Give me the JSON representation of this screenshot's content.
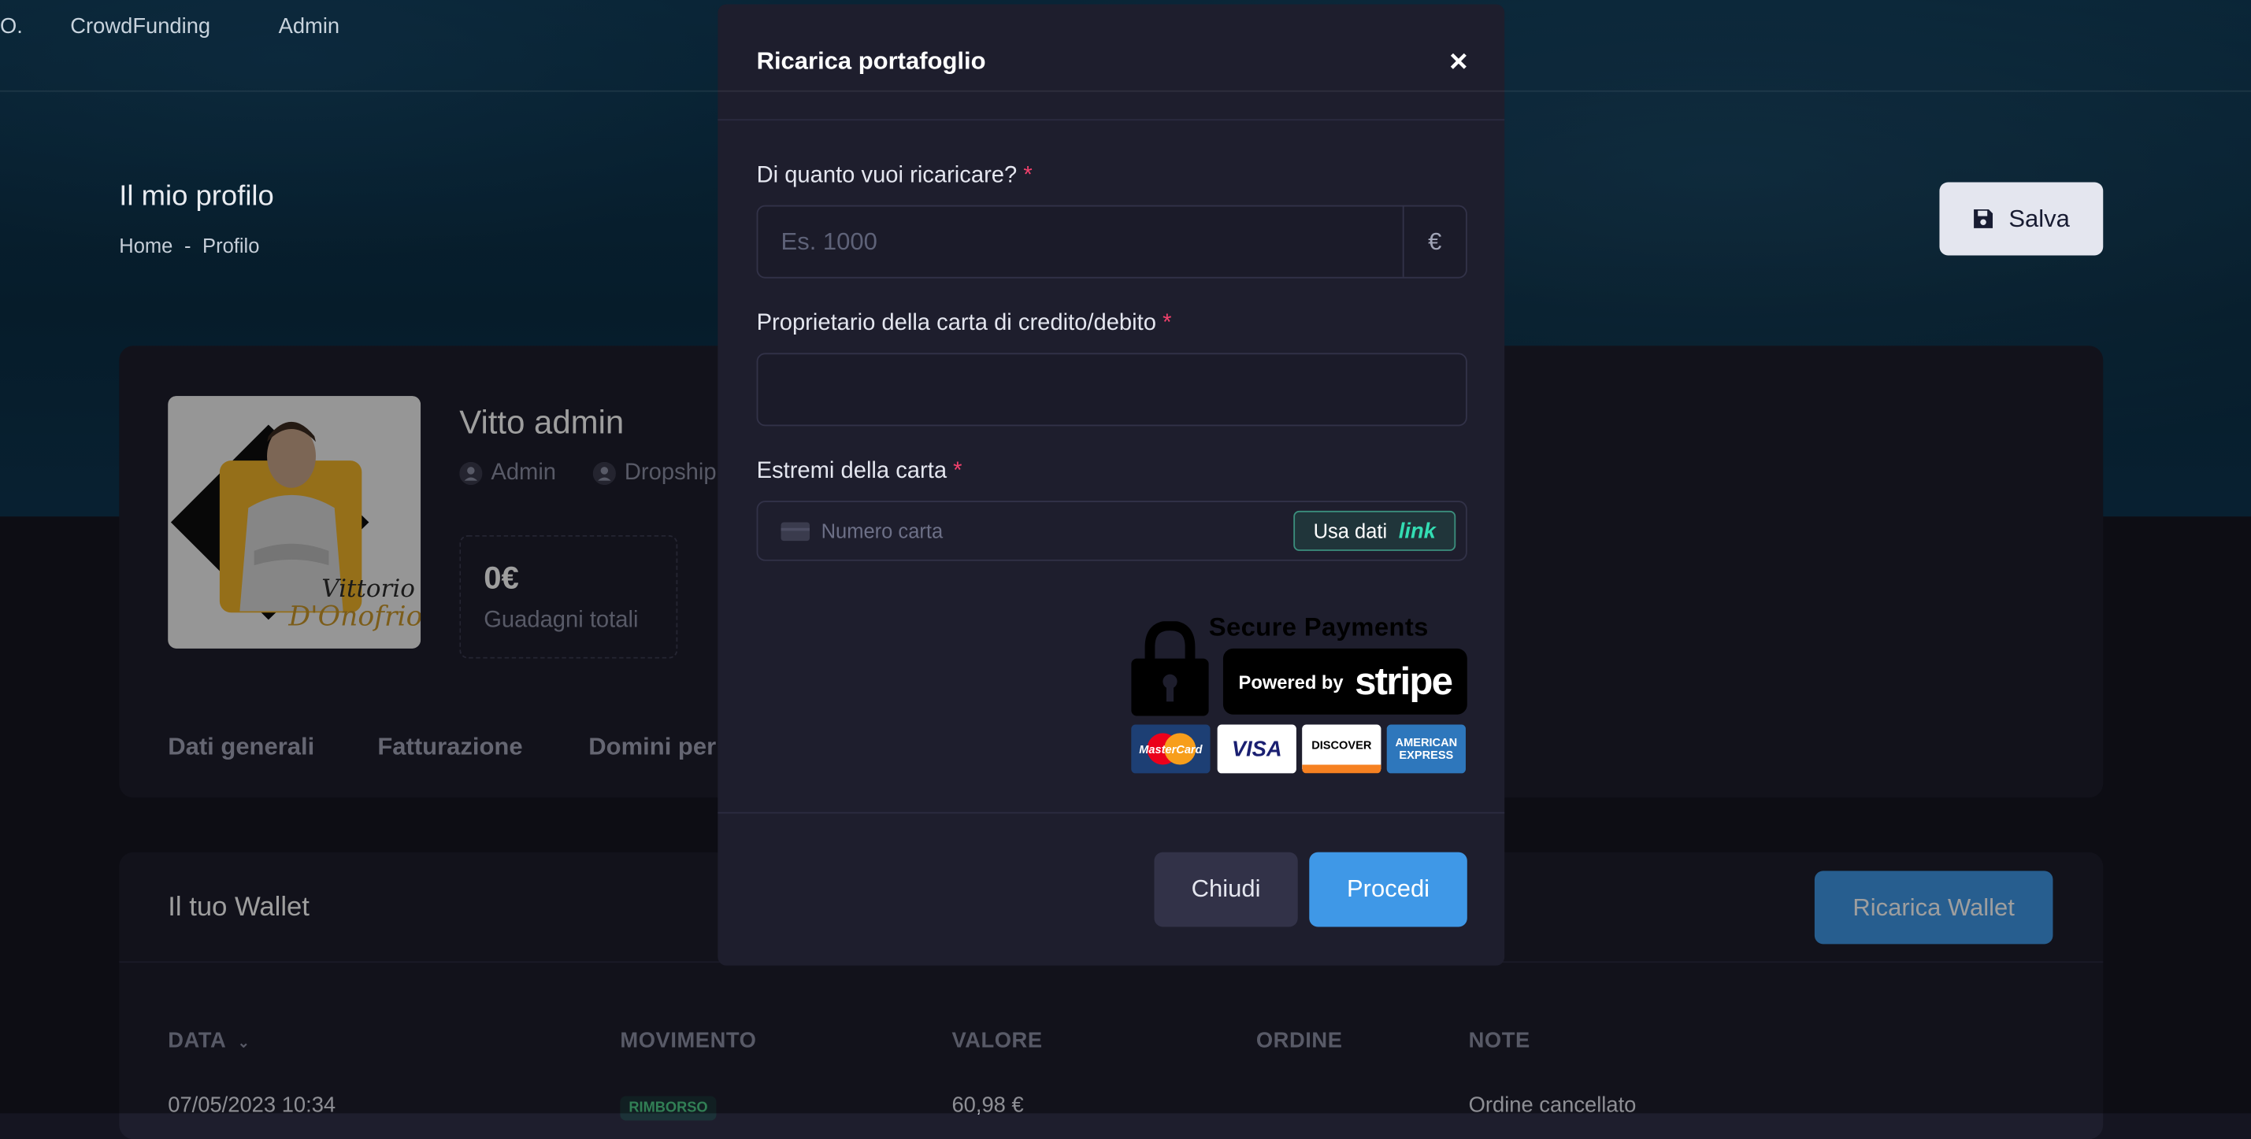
{
  "nav": {
    "items": [
      "O.",
      "CrowdFunding",
      "Admin"
    ]
  },
  "header": {
    "title": "Il mio profilo",
    "breadcrumb": [
      "Home",
      "-",
      "Profilo"
    ],
    "save_label": "Salva"
  },
  "profile": {
    "name": "Vitto admin",
    "roles": [
      "Admin",
      "Dropship"
    ],
    "earnings_value": "0€",
    "earnings_label": "Guadagni totali",
    "avatar_signature": "Vittorio D'Onofrio",
    "tabs": [
      "Dati generali",
      "Fatturazione",
      "Domini per"
    ]
  },
  "wallet": {
    "title": "Il tuo Wallet",
    "recharge_label": "Ricarica Wallet",
    "columns": [
      "DATA",
      "MOVIMENTO",
      "VALORE",
      "ORDINE",
      "NOTE"
    ],
    "rows": [
      {
        "date": "07/05/2023 10:34",
        "movement": "RIMBORSO",
        "value": "60,98 €",
        "order": "",
        "note": "Ordine cancellato"
      }
    ]
  },
  "modal": {
    "title": "Ricarica portafoglio",
    "close_icon": "×",
    "amount_label": "Di quanto vuoi ricaricare?",
    "amount_placeholder": "Es. 1000",
    "amount_value": "",
    "currency": "€",
    "owner_label": "Proprietario della carta di credito/debito",
    "owner_value": "",
    "card_label": "Estremi della carta",
    "card_placeholder": "Numero carta",
    "link_button": "Usa dati",
    "link_word": "link",
    "required_mark": "*",
    "secure_text": "Secure Payments",
    "powered_by": "Powered by",
    "stripe_word": "stripe",
    "card_brands": [
      "MasterCard",
      "VISA",
      "DISCOVER",
      "AMERICAN EXPRESS"
    ],
    "close_label": "Chiudi",
    "proceed_label": "Procedi"
  },
  "colors": {
    "accent": "#3f98e7",
    "required": "#f1416c",
    "modal_bg": "#1e1e2d",
    "page_bg": "#151521"
  }
}
